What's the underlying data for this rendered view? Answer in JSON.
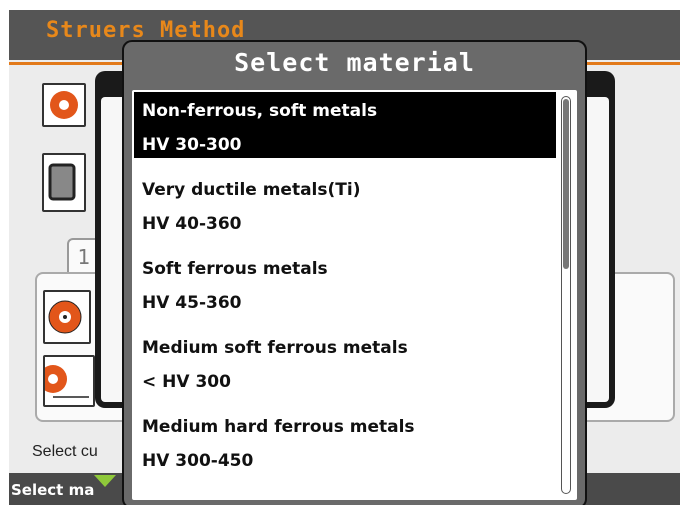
{
  "app": {
    "title": "Struers Method",
    "status_text": "Select cu",
    "footer_text": "Select ma",
    "tab_label": "1"
  },
  "dialog": {
    "title": "Select material",
    "items": [
      {
        "name": "Non-ferrous, soft metals",
        "range": "HV 30-300",
        "selected": true
      },
      {
        "name": "Very ductile metals(Ti)",
        "range": "HV 40-360",
        "selected": false
      },
      {
        "name": "Soft ferrous metals",
        "range": "HV 45-360",
        "selected": false
      },
      {
        "name": "Medium soft ferrous metals",
        "range": "< HV 300",
        "selected": false
      },
      {
        "name": "Medium hard ferrous metals",
        "range": "HV 300-450",
        "selected": false
      }
    ]
  },
  "colors": {
    "accent": "#e8881a",
    "selection": "#000000",
    "footer_arrow": "#8fc93a"
  },
  "icons": [
    "disc-icon",
    "square-toggle-icon",
    "disc-sound-icon",
    "disc-size-icon",
    "scroll-arrow-icon"
  ]
}
